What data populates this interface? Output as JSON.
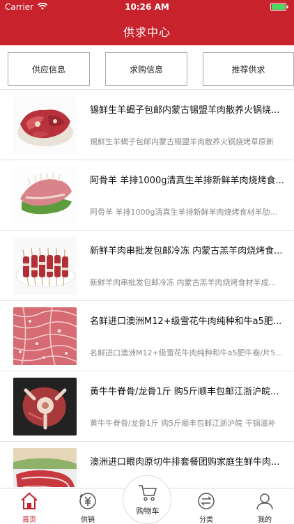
{
  "status_bar": {
    "carrier": "Carrier",
    "time": "10:26 AM"
  },
  "header": {
    "title": "供求中心"
  },
  "segments": [
    "供应信息",
    "求购信息",
    "推荐供求"
  ],
  "products": [
    {
      "title": "锡鲜生羊蝎子包邮内蒙古锡盟羊肉散养火锅烧...",
      "subtitle": "锡鲜生羊蝎子包邮内蒙古锡盟羊肉散养火锅烧烤草原新",
      "image": "lamb-chunks"
    },
    {
      "title": "阿骨羊 羊排1000g清真生羊排新鲜羊肉烧烤食...",
      "subtitle": "阿骨羊 羊排1000g清真生羊排新鲜羊肉烧烤食材羊肋...",
      "image": "lamb-rack"
    },
    {
      "title": "新鲜羊肉串批发包邮冷冻 内蒙古羔羊肉烧烤食...",
      "subtitle": "新鲜羊肉串批发包邮冷冻 内蒙古羔羊肉烧烤食材半成...",
      "image": "skewers"
    },
    {
      "title": "名鲜进口澳洲M12+级雪花牛肉纯种和牛a5肥...",
      "subtitle": "名鲜进口澳洲M12+级雪花牛肉纯种和牛a5肥牛卷/片5...",
      "image": "marbled-beef"
    },
    {
      "title": "黄牛牛脊骨/龙骨1斤 购5斤顺丰包邮江浙沪皖...",
      "subtitle": "黄牛牛脊骨/龙骨1斤 购5斤顺丰包邮江浙沪皖 干锅滋补",
      "image": "beef-bone"
    },
    {
      "title": "澳洲进口眼肉原切牛排套餐团购家庭生鲜牛肉...",
      "subtitle": "",
      "image": "steak"
    }
  ],
  "tabbar": {
    "home": "首页",
    "supply": "供销",
    "cart": "购物车",
    "category": "分类",
    "mine": "我的"
  },
  "colors": {
    "brand": "#c8232c"
  }
}
